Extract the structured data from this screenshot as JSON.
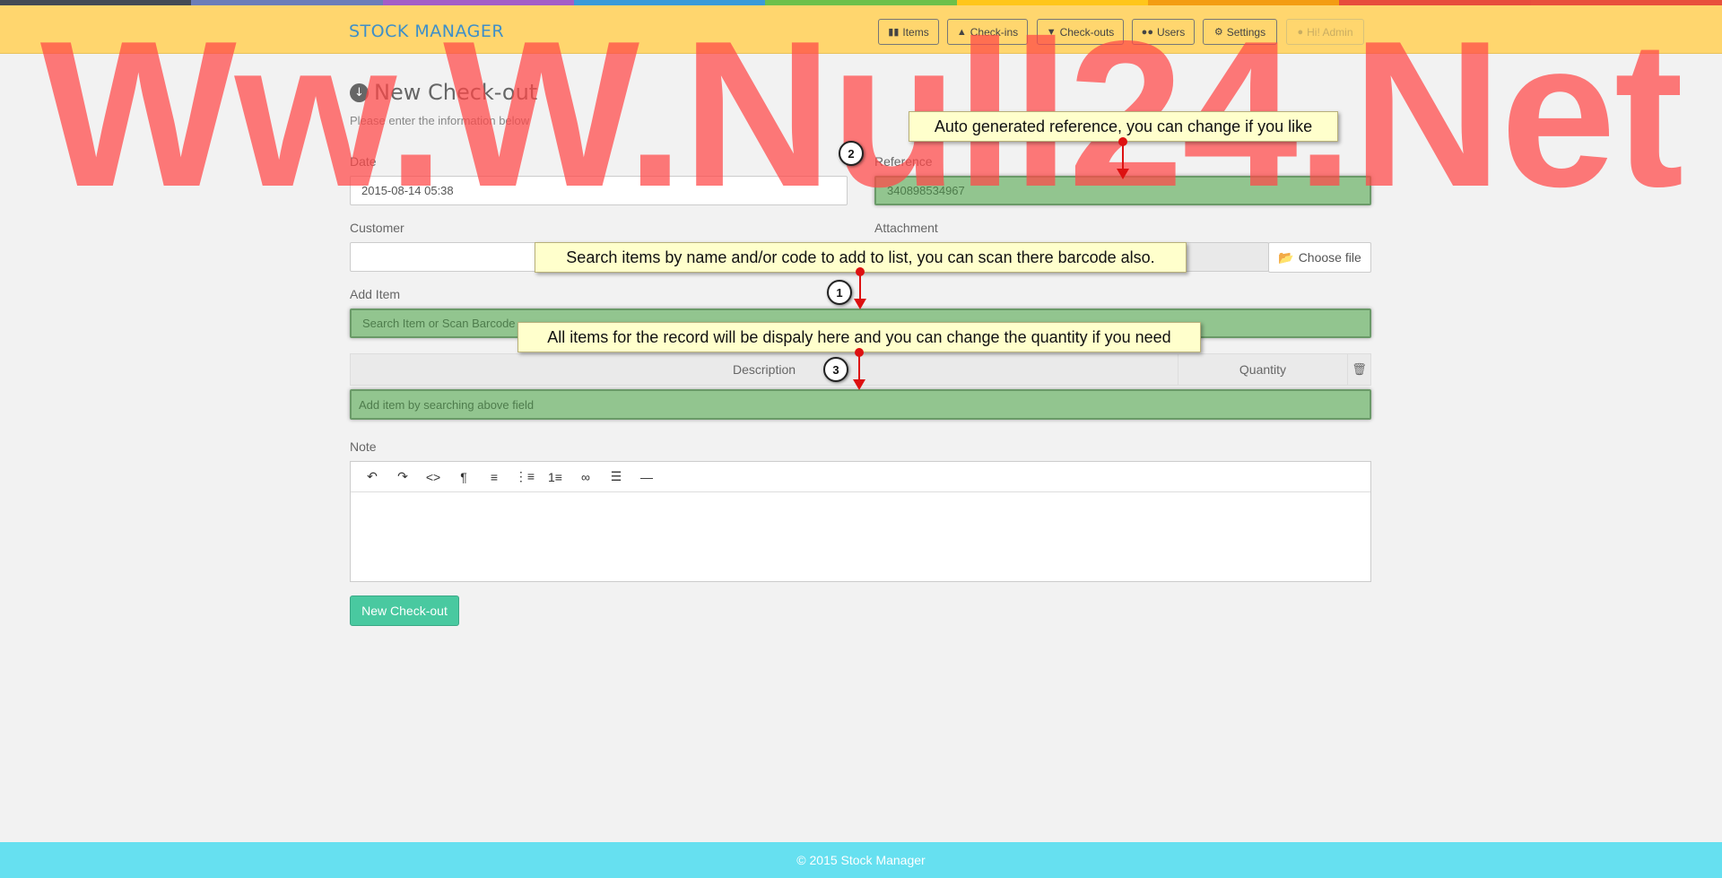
{
  "rainbow_colors": [
    "#444a55",
    "#6b7db8",
    "#a35dc7",
    "#3a9ad9",
    "#6cc04a",
    "#ffc61a",
    "#f39c12",
    "#e74c3c",
    "#e84f3c"
  ],
  "navbar": {
    "brand": "STOCK MANAGER",
    "items": [
      {
        "label": "Items",
        "icon": "barcode-icon"
      },
      {
        "label": "Check-ins",
        "icon": "arrow-circle-up-icon"
      },
      {
        "label": "Check-outs",
        "icon": "arrow-circle-down-icon"
      },
      {
        "label": "Users",
        "icon": "users-icon"
      },
      {
        "label": "Settings",
        "icon": "cogs-icon"
      },
      {
        "label": "Hi! Admin",
        "icon": "user-icon"
      }
    ]
  },
  "page": {
    "title": "New Check-out",
    "subtitle": "Please enter the information below"
  },
  "form": {
    "date_label": "Date",
    "date_value": "2015-08-14 05:38",
    "reference_label": "Reference",
    "reference_value": "340898534967",
    "customer_label": "Customer",
    "customer_value": "",
    "attachment_label": "Attachment",
    "choose_file_label": "Choose file",
    "add_item_label": "Add Item",
    "add_item_placeholder": "Search Item or Scan Barcode",
    "table": {
      "col_description": "Description",
      "col_quantity": "Quantity",
      "empty_row": "Add item by searching above field"
    },
    "note_label": "Note",
    "editor_tools": [
      "undo-icon",
      "redo-icon",
      "code-icon",
      "paragraph-icon",
      "align-icon",
      "unordered-list-icon",
      "ordered-list-icon",
      "link-icon",
      "align-left-icon",
      "horizontal-rule-icon"
    ],
    "submit_label": "New Check-out"
  },
  "tips": [
    {
      "number": "1",
      "text": "Search items by name and/or code to add to list, you can scan there barcode also."
    },
    {
      "number": "2",
      "text": "Auto generated reference, you can change if you like"
    },
    {
      "number": "3",
      "text": "All items for the record will be dispaly here and you can change the quantity if you need"
    }
  ],
  "footer": "© 2015 Stock Manager",
  "watermark": "Ww.W.Null24.Net"
}
